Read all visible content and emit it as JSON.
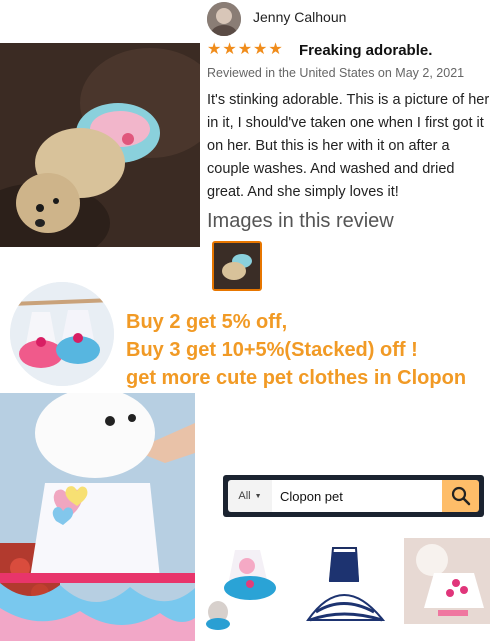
{
  "review": {
    "reviewer_name": "Jenny Calhoun",
    "rating_stars": 5,
    "title": "Freaking adorable.",
    "meta": "Reviewed in the United States on May 2, 2021",
    "body_lines": [
      "It's stinking adorable. This is a picture of her",
      "in it, I should've taken one when I first got it",
      "on her. But this is her with it on after a",
      "couple washes. And washed and dried",
      "great. And she simply loves it!"
    ],
    "images_heading": "Images in this review"
  },
  "promo": {
    "lines": [
      "Buy 2 get 5% off,",
      "Buy 3 get 10+5%(Stacked) off !",
      "get more cute pet clothes in Clopon"
    ]
  },
  "search": {
    "department": "All",
    "query": "Clopon pet"
  },
  "colors": {
    "star": "#f08c1b",
    "promo_text": "#f19a25",
    "search_bar": "#1b2330",
    "search_button": "#febd69",
    "thumb_border": "#e77600"
  }
}
